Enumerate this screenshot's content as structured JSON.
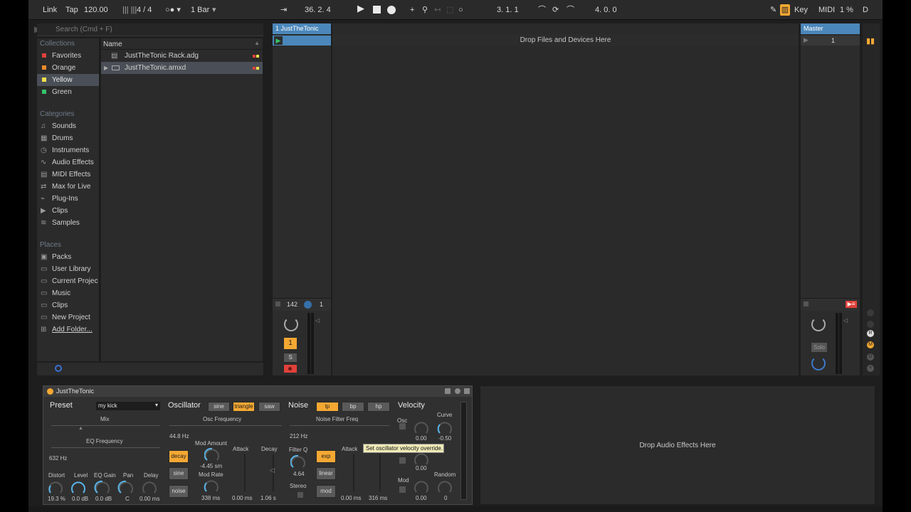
{
  "transport": {
    "link": "Link",
    "tap": "Tap",
    "tempo": "120.00",
    "signature": "4 / 4",
    "quantize": "1 Bar",
    "position": "36.  2.  4",
    "loop_start": "3.  1.  1",
    "loop_length": "4.  0.  0",
    "key": "Key",
    "midi": "MIDI",
    "cpu": "1 %",
    "disk": "D"
  },
  "browser": {
    "search_placeholder": "Search (Cmd + F)",
    "collections_header": "Collections",
    "collections": [
      {
        "label": "Favorites",
        "color": "#e0413a"
      },
      {
        "label": "Orange",
        "color": "#f08b2a"
      },
      {
        "label": "Yellow",
        "color": "#f2df4a"
      },
      {
        "label": "Green",
        "color": "#35c46a"
      }
    ],
    "categories_header": "Categories",
    "categories": [
      {
        "label": "Sounds",
        "icon": "note-icon"
      },
      {
        "label": "Drums",
        "icon": "grid-icon"
      },
      {
        "label": "Instruments",
        "icon": "clock-icon"
      },
      {
        "label": "Audio Effects",
        "icon": "wave-icon"
      },
      {
        "label": "MIDI Effects",
        "icon": "keys-icon"
      },
      {
        "label": "Max for Live",
        "icon": "loop-icon"
      },
      {
        "label": "Plug-Ins",
        "icon": "plug-icon"
      },
      {
        "label": "Clips",
        "icon": "play-icon"
      },
      {
        "label": "Samples",
        "icon": "waveform-icon"
      }
    ],
    "places_header": "Places",
    "places": [
      {
        "label": "Packs",
        "icon": "packs-icon"
      },
      {
        "label": "User Library",
        "icon": "folder-icon"
      },
      {
        "label": "Current Projec",
        "icon": "folder-icon"
      },
      {
        "label": "Music",
        "icon": "folder-icon"
      },
      {
        "label": "Clips",
        "icon": "folder-icon"
      },
      {
        "label": "New Project",
        "icon": "folder-icon"
      },
      {
        "label": "Add Folder...",
        "icon": "add-folder-icon"
      }
    ],
    "name_header": "Name",
    "files": [
      {
        "label": "JustTheTonic Rack.adg"
      },
      {
        "label": "JustTheTonic.amxd"
      }
    ]
  },
  "session": {
    "track_name": "1 JustTheTonic",
    "drop_files": "Drop Files and Devices Here",
    "master_name": "Master",
    "master_scene": "1",
    "track_count_value": "142",
    "track_output": "1",
    "track_number": "1",
    "solo": "S",
    "master_solo": "Solo"
  },
  "device": {
    "title": "JustTheTonic",
    "preset_label": "Preset",
    "preset_value": "my kick",
    "mix": "Mix",
    "eq_frequency": "EQ Frequency",
    "eq_freq_value": "632 Hz",
    "knobs_bottom": [
      {
        "label": "Distort",
        "value": "19.3 %"
      },
      {
        "label": "Level",
        "value": "0.0 dB"
      },
      {
        "label": "EQ Gain",
        "value": "0.0 dB"
      },
      {
        "label": "Pan",
        "value": "C"
      },
      {
        "label": "Delay",
        "value": "0.00 ms"
      }
    ],
    "osc_header": "Oscillator",
    "osc_waves": [
      "sine",
      "triangle",
      "saw"
    ],
    "osc_frequency": "Osc Frequency",
    "osc_freq_value": "44.8 Hz",
    "mod_amount": "Mod Amount",
    "mod_amount_value": "-4.45 sm",
    "mod_rate": "Mod Rate",
    "mod_rate_value": "338 ms",
    "osc_mod_buttons": [
      "decay",
      "sine",
      "noise"
    ],
    "attack": "Attack",
    "decay": "Decay",
    "osc_attack_value": "0.00 ms",
    "osc_decay_value": "1.06 s",
    "noise_header": "Noise",
    "filter_types": [
      "lp",
      "bp",
      "hp"
    ],
    "noise_filter_freq": "Noise Filter Freq",
    "noise_freq_value": "212 Hz",
    "filter_q": "Filter Q",
    "filter_q_value": "4.64",
    "stereo": "Stereo",
    "env_buttons": [
      "exp",
      "linear",
      "mod"
    ],
    "noise_attack": "Attack",
    "noise_attack_value": "0.00 ms",
    "noise_decay_value": "316 ms",
    "velocity_header": "Velocity",
    "osc": "Osc",
    "curve": "Curve",
    "vel_osc_value": "0.00",
    "curve_value": "-0.50",
    "vel_mid_value": "0.00",
    "mod": "Mod",
    "random": "Random",
    "vel_mod_value": "0.00",
    "random_value": "0",
    "tooltip": "Set oscillator velocity override."
  },
  "audio_effects": {
    "drop": "Drop Audio Effects Here"
  },
  "colors": {
    "accent": "#f4a833",
    "track_blue": "#4b87ba",
    "knob_blue": "#58b4e8"
  }
}
